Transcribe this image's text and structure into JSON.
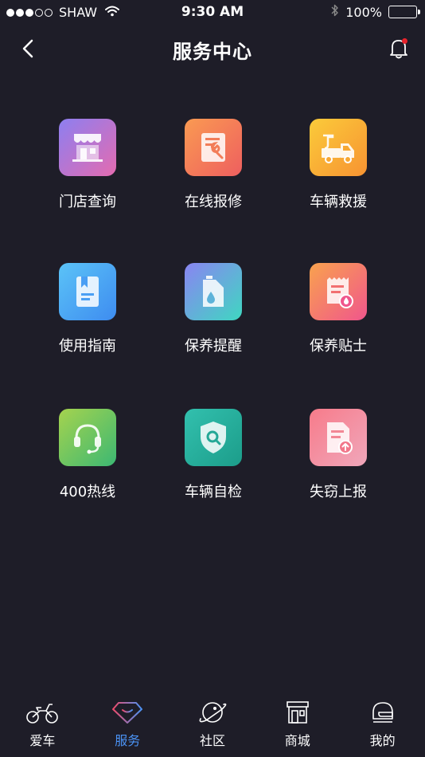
{
  "status_bar": {
    "carrier": "SHAW",
    "time": "9:30 AM",
    "battery": "100%",
    "signal_bars_filled": 3,
    "signal_bars_total": 5,
    "battery_level": 1.0,
    "icons": [
      "signal-dots-icon",
      "wifi-icon",
      "bluetooth-icon",
      "battery-icon"
    ]
  },
  "nav": {
    "title": "服务中心",
    "back_icon": "chevron-left-icon",
    "bell_icon": "bell-icon",
    "has_notification_dot": true
  },
  "services": [
    {
      "label": "门店查询",
      "icon": "store-icon"
    },
    {
      "label": "在线报修",
      "icon": "repair-form-icon"
    },
    {
      "label": "车辆救援",
      "icon": "tow-truck-icon"
    },
    {
      "label": "使用指南",
      "icon": "guide-book-icon"
    },
    {
      "label": "保养提醒",
      "icon": "oil-can-icon"
    },
    {
      "label": "保养贴士",
      "icon": "receipt-tips-icon"
    },
    {
      "label": "400热线",
      "icon": "headset-icon"
    },
    {
      "label": "车辆自检",
      "icon": "shield-search-icon"
    },
    {
      "label": "失窃上报",
      "icon": "report-upload-icon"
    }
  ],
  "tabs": [
    {
      "label": "爱车",
      "icon": "motorcycle-icon",
      "active": false
    },
    {
      "label": "服务",
      "icon": "diamond-icon",
      "active": true
    },
    {
      "label": "社区",
      "icon": "planet-icon",
      "active": false
    },
    {
      "label": "商城",
      "icon": "shop-icon",
      "active": false
    },
    {
      "label": "我的",
      "icon": "helmet-icon",
      "active": false
    }
  ],
  "colors": {
    "background": "#1e1d28",
    "text": "#ffffff",
    "active_tab": "#4b93f5",
    "notification_dot": "#e8232b"
  }
}
